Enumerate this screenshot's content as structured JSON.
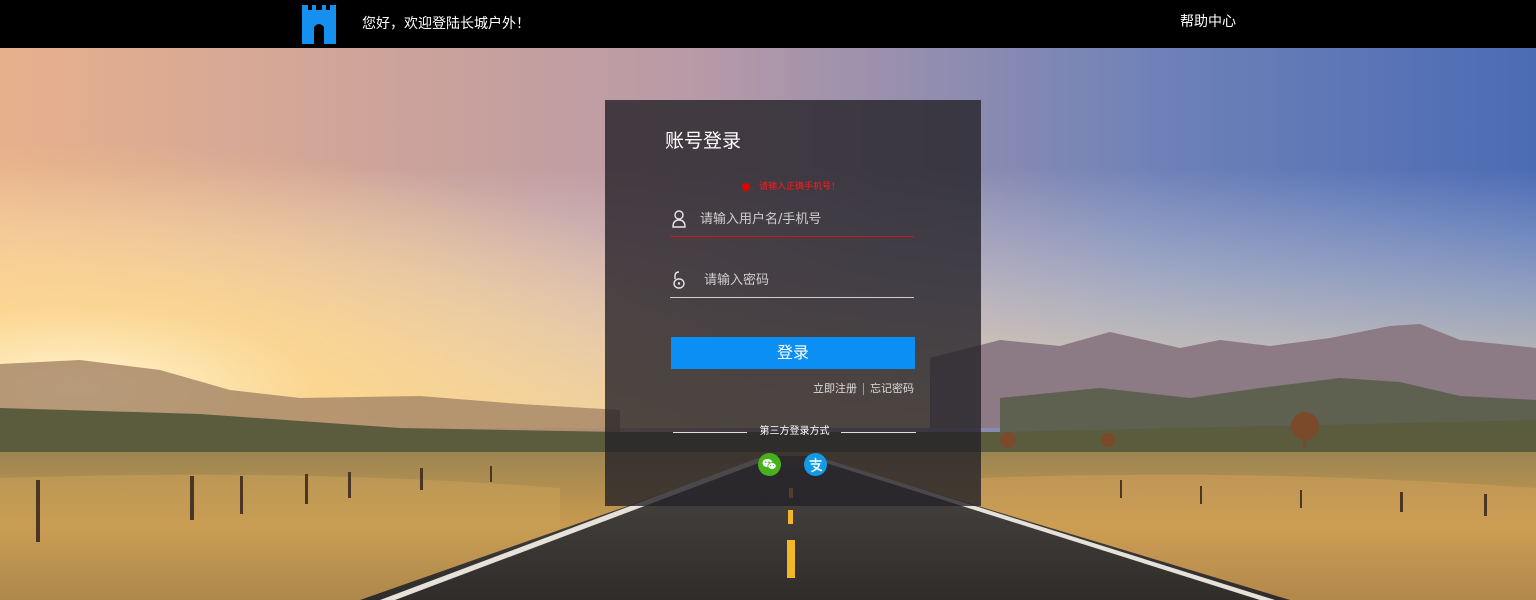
{
  "header": {
    "greeting": "您好，欢迎登陆长城户外！",
    "help_link": "帮助中心"
  },
  "login": {
    "title": "账号登录",
    "error_message": "请输入正确手机号！",
    "username_placeholder": "请输入用户名/手机号",
    "password_placeholder": "请输入密码",
    "submit_label": "登录",
    "register_link": "立即注册",
    "forgot_link": "忘记密码",
    "third_party_label": "第三方登录方式",
    "third_party": [
      {
        "icon": "wechat-icon",
        "color": "#46b11a"
      },
      {
        "icon": "alipay-icon",
        "color": "#129ae6"
      }
    ]
  },
  "colors": {
    "accent": "#0b8ff5",
    "logo": "#1690f0",
    "error": "#ff1a1a",
    "topbar": "#000000"
  }
}
